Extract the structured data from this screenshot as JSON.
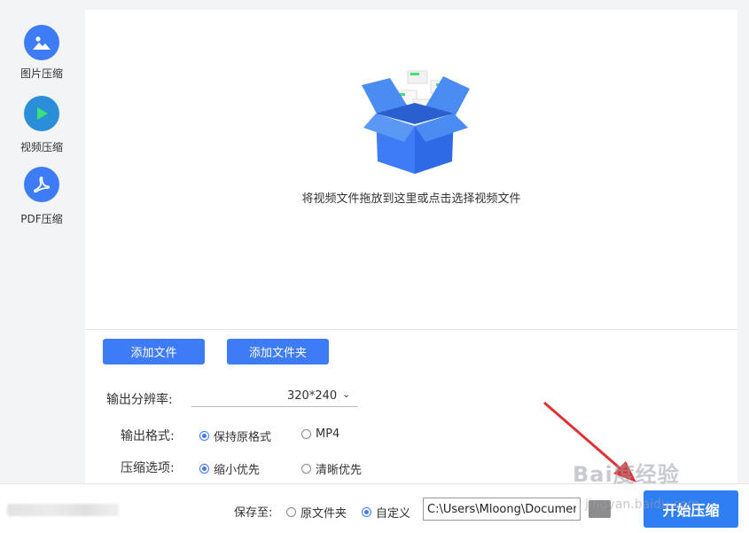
{
  "sidebar": {
    "items": [
      {
        "label": "图片压缩",
        "icon": "image-icon",
        "color": "#3d7cf4"
      },
      {
        "label": "视频压缩",
        "icon": "play-icon",
        "color": "#2a8ed8",
        "active": true,
        "accent": "#3ee07a"
      },
      {
        "label": "PDF压缩",
        "icon": "pdf-icon",
        "color": "#3d7cf4"
      }
    ]
  },
  "dropzone": {
    "text": "将视频文件拖放到这里或点击选择视频文件",
    "illustration_icon": "open-box-icon"
  },
  "actions": {
    "add_file": "添加文件",
    "add_folder": "添加文件夹"
  },
  "options": {
    "resolution_label": "输出分辨率:",
    "resolution_value": "320*240",
    "format_label": "输出格式:",
    "format_options": [
      {
        "label": "保持原格式",
        "checked": true
      },
      {
        "label": "MP4",
        "checked": false
      }
    ],
    "compress_label": "压缩选项:",
    "compress_options": [
      {
        "label": "缩小优先",
        "checked": true
      },
      {
        "label": "清晰优先",
        "checked": false
      }
    ]
  },
  "bottom": {
    "save_to_label": "保存至:",
    "save_options": [
      {
        "label": "原文件夹",
        "checked": false
      },
      {
        "label": "自定义",
        "checked": true
      }
    ],
    "path_value": "C:\\Users\\Mloong\\Documents",
    "start_button": "开始压缩"
  },
  "watermark": {
    "main": "Bai度经验",
    "sub": "jingyan.baidu.com"
  },
  "colors": {
    "accent": "#3d7cf4",
    "start_button": "#2f7ff3",
    "annotation_arrow": "#e03030"
  }
}
